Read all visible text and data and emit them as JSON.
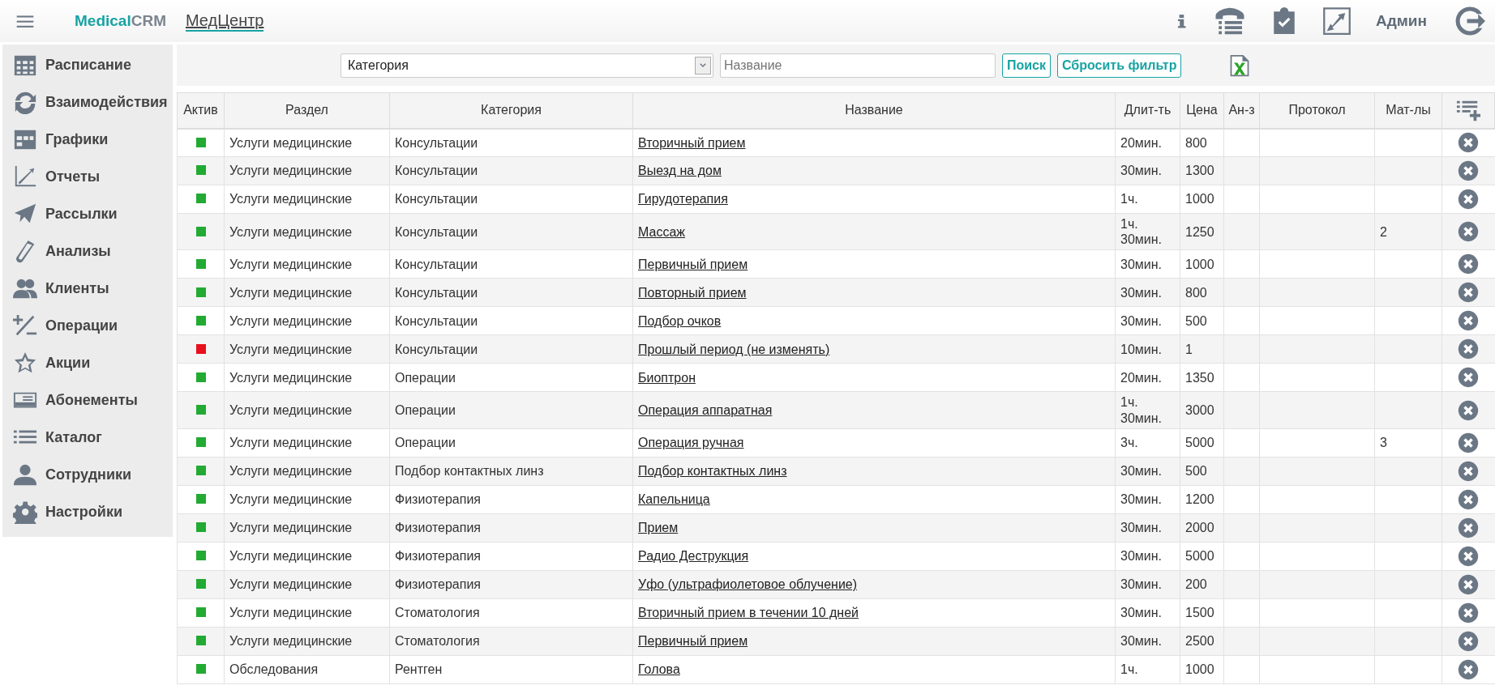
{
  "header": {
    "brand_primary": "Medical",
    "brand_secondary": "CRM",
    "clinic": "МедЦентр",
    "user": "Админ"
  },
  "sidebar": {
    "items": [
      {
        "label": "Расписание",
        "kind": "calendar"
      },
      {
        "label": "Взаимодействия",
        "kind": "sync"
      },
      {
        "label": "Графики",
        "kind": "grid"
      },
      {
        "label": "Отчеты",
        "kind": "chart"
      },
      {
        "label": "Рассылки",
        "kind": "plane"
      },
      {
        "label": "Анализы",
        "kind": "tube"
      },
      {
        "label": "Клиенты",
        "kind": "people"
      },
      {
        "label": "Операции",
        "kind": "plusminus"
      },
      {
        "label": "Акции",
        "kind": "star"
      },
      {
        "label": "Абонементы",
        "kind": "card"
      },
      {
        "label": "Каталог",
        "kind": "list"
      },
      {
        "label": "Сотрудники",
        "kind": "person"
      },
      {
        "label": "Настройки",
        "kind": "gear"
      }
    ]
  },
  "filter": {
    "category": "Категория",
    "name_placeholder": "Название",
    "search_button": "Поиск",
    "reset_button": "Сбросить фильтр"
  },
  "table": {
    "columns": [
      "Актив",
      "Раздел",
      "Категория",
      "Название",
      "Длит-ть",
      "Цена",
      "Ан-з",
      "Протокол",
      "Мат-лы"
    ],
    "rows": [
      {
        "active": true,
        "section": "Услуги медицинские",
        "category": "Консультации",
        "name": "Вторичный прием",
        "duration": "20мин.",
        "price": "800"
      },
      {
        "active": true,
        "section": "Услуги медицинские",
        "category": "Консультации",
        "name": "Выезд на дом",
        "duration": "30мин.",
        "price": "1300"
      },
      {
        "active": true,
        "section": "Услуги медицинские",
        "category": "Консультации",
        "name": "Гирудотерапия",
        "duration": "1ч.",
        "price": "1000"
      },
      {
        "active": true,
        "section": "Услуги медицинские",
        "category": "Консультации",
        "name": "Массаж",
        "duration": "1ч. 30мин.",
        "price": "1250",
        "materials": "2"
      },
      {
        "active": true,
        "section": "Услуги медицинские",
        "category": "Консультации",
        "name": "Первичный прием",
        "duration": "30мин.",
        "price": "1000"
      },
      {
        "active": true,
        "section": "Услуги медицинские",
        "category": "Консультации",
        "name": "Повторный прием",
        "duration": "30мин.",
        "price": "800"
      },
      {
        "active": true,
        "section": "Услуги медицинские",
        "category": "Консультации",
        "name": "Подбор очков",
        "duration": "30мин.",
        "price": "500"
      },
      {
        "active": false,
        "section": "Услуги медицинские",
        "category": "Консультации",
        "name": "Прошлый период (не изменять)",
        "duration": "10мин.",
        "price": "1"
      },
      {
        "active": true,
        "section": "Услуги медицинские",
        "category": "Операции",
        "name": "Биоптрон",
        "duration": "20мин.",
        "price": "1350"
      },
      {
        "active": true,
        "section": "Услуги медицинские",
        "category": "Операции",
        "name": "Операция аппаратная",
        "duration": "1ч. 30мин.",
        "price": "3000"
      },
      {
        "active": true,
        "section": "Услуги медицинские",
        "category": "Операции",
        "name": "Операция ручная",
        "duration": "3ч.",
        "price": "5000",
        "materials": "3"
      },
      {
        "active": true,
        "section": "Услуги медицинские",
        "category": "Подбор контактных линз",
        "name": "Подбор контактных линз",
        "duration": "30мин.",
        "price": "500"
      },
      {
        "active": true,
        "section": "Услуги медицинские",
        "category": "Физиотерапия",
        "name": "Капельница",
        "duration": "30мин.",
        "price": "1200"
      },
      {
        "active": true,
        "section": "Услуги медицинские",
        "category": "Физиотерапия",
        "name": "Прием",
        "duration": "30мин.",
        "price": "2000"
      },
      {
        "active": true,
        "section": "Услуги медицинские",
        "category": "Физиотерапия",
        "name": "Радио Деструкция",
        "duration": "30мин.",
        "price": "5000"
      },
      {
        "active": true,
        "section": "Услуги медицинские",
        "category": "Физиотерапия",
        "name": "Уфо (ультрафиолетовое облучение)",
        "duration": "30мин.",
        "price": "200"
      },
      {
        "active": true,
        "section": "Услуги медицинские",
        "category": "Стоматология",
        "name": "Вторичный прием в течении 10 дней",
        "duration": "30мин.",
        "price": "1500"
      },
      {
        "active": true,
        "section": "Услуги медицинские",
        "category": "Стоматология",
        "name": "Первичный прием",
        "duration": "30мин.",
        "price": "2500"
      },
      {
        "active": true,
        "section": "Обследования",
        "category": "Рентген",
        "name": "Голова",
        "duration": "1ч.",
        "price": "1000"
      }
    ]
  }
}
